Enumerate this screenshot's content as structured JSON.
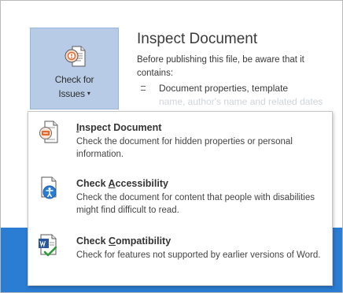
{
  "check_button": {
    "label_line1": "Check for",
    "label_line2": "Issues",
    "caret": "▾",
    "icon": "check-for-issues-icon"
  },
  "info": {
    "title": "Inspect Document",
    "description": "Before publishing this file, be aware that it contains:",
    "bullet": "Document properties, template",
    "faded_text": "name, author's name and related dates"
  },
  "menu": {
    "items": [
      {
        "title_pre": "",
        "title_mnemonic": "I",
        "title_post": "nspect Document",
        "description": "Check the document for hidden properties or personal information.",
        "icon": "inspect-document-icon"
      },
      {
        "title_pre": "Check ",
        "title_mnemonic": "A",
        "title_post": "ccessibility",
        "description": "Check the document for content that people with disabilities might find difficult to read.",
        "icon": "accessibility-icon"
      },
      {
        "title_pre": "Check ",
        "title_mnemonic": "C",
        "title_post": "ompatibility",
        "description": "Check for features not supported by earlier versions of Word.",
        "icon": "compatibility-icon"
      }
    ]
  },
  "colors": {
    "backstage_blue": "#2b7cd3",
    "button_selected": "#b7cbe7",
    "word_blue": "#2b579a",
    "accent_orange": "#e3692d"
  }
}
